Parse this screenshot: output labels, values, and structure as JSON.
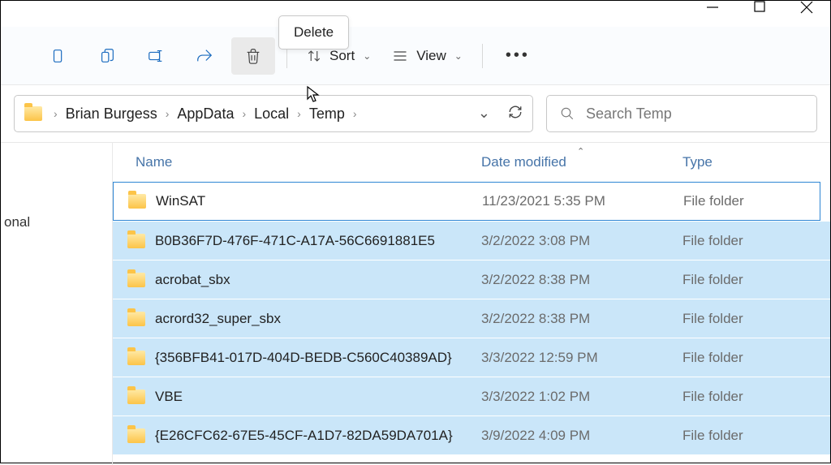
{
  "tooltip": "Delete",
  "toolbar": {
    "sort_label": "Sort",
    "view_label": "View"
  },
  "breadcrumb": [
    "Brian Burgess",
    "AppData",
    "Local",
    "Temp"
  ],
  "search_placeholder": "Search Temp",
  "sidebar": {
    "items": [
      "onal"
    ]
  },
  "columns": {
    "name": "Name",
    "date": "Date modified",
    "type": "Type"
  },
  "rows": [
    {
      "name": "WinSAT",
      "date": "11/23/2021 5:35 PM",
      "type": "File folder",
      "selected": false
    },
    {
      "name": "B0B36F7D-476F-471C-A17A-56C6691881E5",
      "date": "3/2/2022 3:08 PM",
      "type": "File folder",
      "selected": true
    },
    {
      "name": "acrobat_sbx",
      "date": "3/2/2022 8:38 PM",
      "type": "File folder",
      "selected": true
    },
    {
      "name": "acrord32_super_sbx",
      "date": "3/2/2022 8:38 PM",
      "type": "File folder",
      "selected": true
    },
    {
      "name": "{356BFB41-017D-404D-BEDB-C560C40389AD}",
      "date": "3/3/2022 12:59 PM",
      "type": "File folder",
      "selected": true
    },
    {
      "name": "VBE",
      "date": "3/3/2022 1:02 PM",
      "type": "File folder",
      "selected": true
    },
    {
      "name": "{E26CFC62-67E5-45CF-A1D7-82DA59DA701A}",
      "date": "3/9/2022 4:09 PM",
      "type": "File folder",
      "selected": true
    }
  ]
}
